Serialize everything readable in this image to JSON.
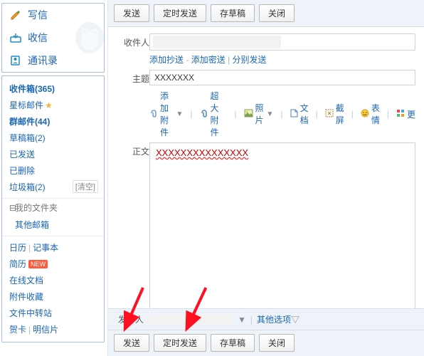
{
  "sidebar": {
    "compose": [
      {
        "label": "写信",
        "icon": "compose-icon"
      },
      {
        "label": "收信",
        "icon": "inbox-icon"
      },
      {
        "label": "通讯录",
        "icon": "contacts-icon"
      }
    ],
    "folders": [
      {
        "label": "收件箱(365)",
        "bold": true
      },
      {
        "label": "星标邮件",
        "star": true
      },
      {
        "label": "群邮件(44)",
        "bold": true
      },
      {
        "label": "草稿箱(2)"
      },
      {
        "label": "已发送"
      },
      {
        "label": "已删除"
      },
      {
        "label": "垃圾箱(2)",
        "clear": "[清空]"
      }
    ],
    "myfolders_head": "我的文件夹",
    "myfolders": [
      {
        "label": "其他邮箱"
      }
    ],
    "tools": [
      {
        "label": "日历"
      },
      {
        "label": "记事本",
        "same_line_after": 0
      },
      {
        "label": "简历",
        "badge": "NEW"
      },
      {
        "label": "在线文档"
      },
      {
        "label": "附件收藏"
      },
      {
        "label": "文件中转站"
      },
      {
        "label": "贺卡"
      },
      {
        "label": "明信片",
        "same_line_after": 6
      }
    ],
    "tool_lines": [
      "日历 | 记事本",
      "简历",
      "在线文档",
      "附件收藏",
      "文件中转站",
      "贺卡 | 明信片"
    ]
  },
  "toolbar": {
    "send": "发送",
    "timed": "定时发送",
    "draft": "存草稿",
    "close": "关闭"
  },
  "compose": {
    "to_label": "收件人",
    "add_cc": "添加抄送",
    "add_bcc": "添加密送",
    "split_send": "分别发送",
    "subject_label": "主题",
    "subject_value": "XXXXXXX",
    "body_label": "正文",
    "body_value": "XXXXXXXXXXXXXXX",
    "sender_label": "发件人",
    "other_options": "其他选项"
  },
  "attachbar": {
    "attach": "添加附件",
    "big": "超大附件",
    "photo": "照片",
    "doc": "文档",
    "screenshot": "截屏",
    "emoji": "表情",
    "more": "更"
  }
}
